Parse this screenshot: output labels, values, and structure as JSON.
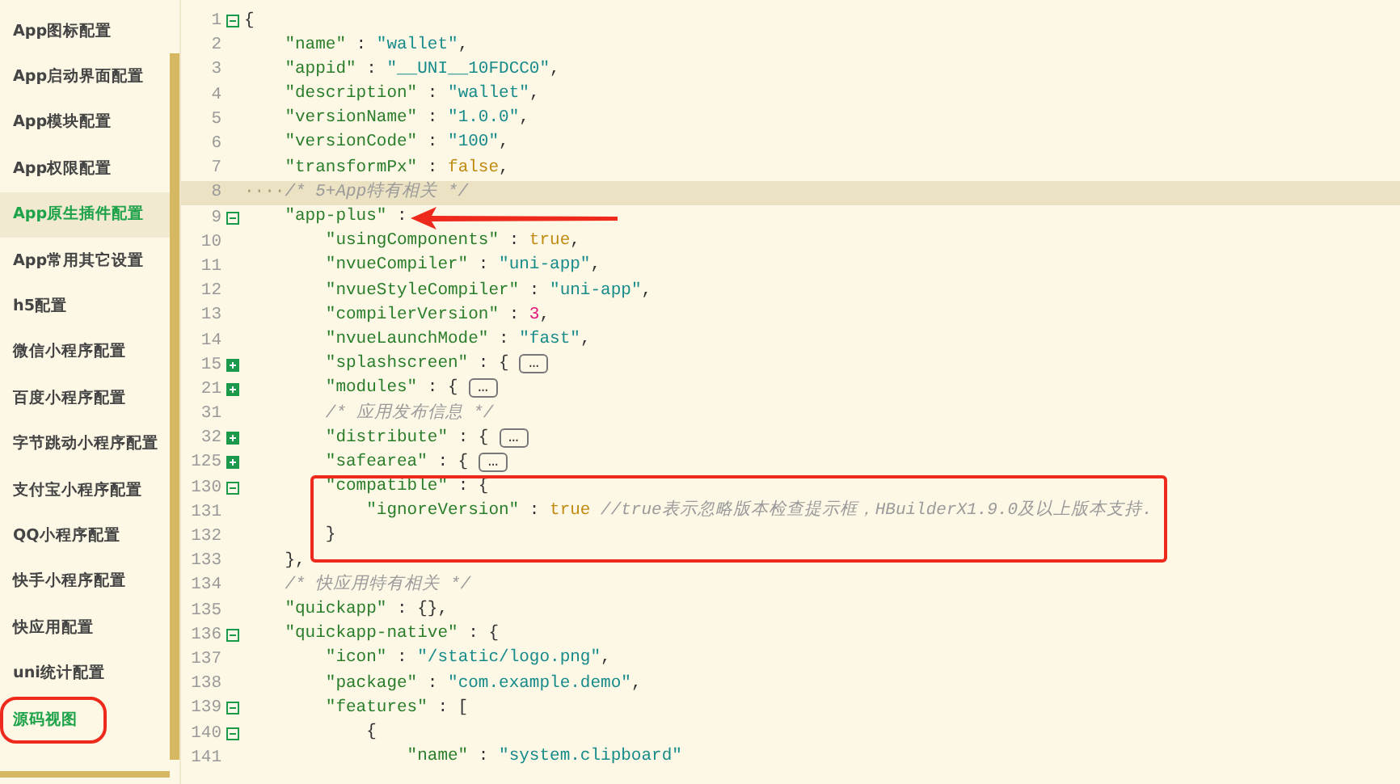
{
  "sidebar": {
    "items": [
      {
        "label": "App图标配置",
        "selected": false,
        "active": false,
        "circled": false
      },
      {
        "label": "App启动界面配置",
        "selected": false,
        "active": false,
        "circled": false
      },
      {
        "label": "App模块配置",
        "selected": false,
        "active": false,
        "circled": false
      },
      {
        "label": "App权限配置",
        "selected": false,
        "active": false,
        "circled": false
      },
      {
        "label": "App原生插件配置",
        "selected": true,
        "active": true,
        "circled": false
      },
      {
        "label": "App常用其它设置",
        "selected": false,
        "active": false,
        "circled": false
      },
      {
        "label": "h5配置",
        "selected": false,
        "active": false,
        "circled": false
      },
      {
        "label": "微信小程序配置",
        "selected": false,
        "active": false,
        "circled": false
      },
      {
        "label": "百度小程序配置",
        "selected": false,
        "active": false,
        "circled": false
      },
      {
        "label": "字节跳动小程序配置",
        "selected": false,
        "active": false,
        "circled": false
      },
      {
        "label": "支付宝小程序配置",
        "selected": false,
        "active": false,
        "circled": false
      },
      {
        "label": "QQ小程序配置",
        "selected": false,
        "active": false,
        "circled": false
      },
      {
        "label": "快手小程序配置",
        "selected": false,
        "active": false,
        "circled": false
      },
      {
        "label": "快应用配置",
        "selected": false,
        "active": false,
        "circled": false
      },
      {
        "label": "uni统计配置",
        "selected": false,
        "active": false,
        "circled": false
      },
      {
        "label": "源码视图",
        "selected": false,
        "active": true,
        "circled": true
      }
    ]
  },
  "editor": {
    "lines": [
      {
        "num": "1",
        "collapsed": false,
        "tokens": [
          {
            "kind": "punct",
            "text": "{"
          }
        ],
        "children": [
          {
            "num": "2",
            "tokens": [
              {
                "kind": "key",
                "text": "\"name\""
              },
              {
                "kind": "punct",
                "text": " : "
              },
              {
                "kind": "string",
                "text": "\"wallet\""
              },
              {
                "kind": "punct",
                "text": ","
              }
            ]
          },
          {
            "num": "3",
            "tokens": [
              {
                "kind": "key",
                "text": "\"appid\""
              },
              {
                "kind": "punct",
                "text": " : "
              },
              {
                "kind": "string",
                "text": "\"__UNI__10FDCC0\""
              },
              {
                "kind": "punct",
                "text": ","
              }
            ]
          },
          {
            "num": "4",
            "tokens": [
              {
                "kind": "key",
                "text": "\"description\""
              },
              {
                "kind": "punct",
                "text": " : "
              },
              {
                "kind": "string",
                "text": "\"wallet\""
              },
              {
                "kind": "punct",
                "text": ","
              }
            ]
          },
          {
            "num": "5",
            "tokens": [
              {
                "kind": "key",
                "text": "\"versionName\""
              },
              {
                "kind": "punct",
                "text": " : "
              },
              {
                "kind": "string",
                "text": "\"1.0.0\""
              },
              {
                "kind": "punct",
                "text": ","
              }
            ]
          },
          {
            "num": "6",
            "tokens": [
              {
                "kind": "key",
                "text": "\"versionCode\""
              },
              {
                "kind": "punct",
                "text": " : "
              },
              {
                "kind": "string",
                "text": "\"100\""
              },
              {
                "kind": "punct",
                "text": ","
              }
            ]
          },
          {
            "num": "7",
            "tokens": [
              {
                "kind": "key",
                "text": "\"transformPx\""
              },
              {
                "kind": "punct",
                "text": " : "
              },
              {
                "kind": "literal",
                "text": "false"
              },
              {
                "kind": "punct",
                "text": ","
              }
            ]
          },
          {
            "num": "8",
            "highlighted": true,
            "tokens": [
              {
                "kind": "whitespace",
                "text": "····"
              },
              {
                "kind": "comment",
                "text": "/* 5+App特有相关 */"
              }
            ]
          },
          {
            "num": "9",
            "collapsed": false,
            "tokens": [
              {
                "kind": "key",
                "text": "\"app-plus\""
              },
              {
                "kind": "punct",
                "text": " :"
              }
            ],
            "children": [
              {
                "num": "10",
                "tokens": [
                  {
                    "kind": "key",
                    "text": "\"usingComponents\""
                  },
                  {
                    "kind": "punct",
                    "text": " : "
                  },
                  {
                    "kind": "literal",
                    "text": "true"
                  },
                  {
                    "kind": "punct",
                    "text": ","
                  }
                ]
              },
              {
                "num": "11",
                "tokens": [
                  {
                    "kind": "key",
                    "text": "\"nvueCompiler\""
                  },
                  {
                    "kind": "punct",
                    "text": " : "
                  },
                  {
                    "kind": "string",
                    "text": "\"uni-app\""
                  },
                  {
                    "kind": "punct",
                    "text": ","
                  }
                ]
              },
              {
                "num": "12",
                "tokens": [
                  {
                    "kind": "key",
                    "text": "\"nvueStyleCompiler\""
                  },
                  {
                    "kind": "punct",
                    "text": " : "
                  },
                  {
                    "kind": "string",
                    "text": "\"uni-app\""
                  },
                  {
                    "kind": "punct",
                    "text": ","
                  }
                ]
              },
              {
                "num": "13",
                "tokens": [
                  {
                    "kind": "key",
                    "text": "\"compilerVersion\""
                  },
                  {
                    "kind": "punct",
                    "text": " : "
                  },
                  {
                    "kind": "number",
                    "text": "3"
                  },
                  {
                    "kind": "punct",
                    "text": ","
                  }
                ]
              },
              {
                "num": "14",
                "tokens": [
                  {
                    "kind": "key",
                    "text": "\"nvueLaunchMode\""
                  },
                  {
                    "kind": "punct",
                    "text": " : "
                  },
                  {
                    "kind": "string",
                    "text": "\"fast\""
                  },
                  {
                    "kind": "punct",
                    "text": ","
                  }
                ]
              },
              {
                "num": "15",
                "collapsed": true,
                "tokens": [
                  {
                    "kind": "key",
                    "text": "\"splashscreen\""
                  },
                  {
                    "kind": "punct",
                    "text": " : { "
                  },
                  {
                    "kind": "ellipsis",
                    "text": "…"
                  }
                ]
              },
              {
                "num": "21",
                "collapsed": true,
                "tokens": [
                  {
                    "kind": "key",
                    "text": "\"modules\""
                  },
                  {
                    "kind": "punct",
                    "text": " : { "
                  },
                  {
                    "kind": "ellipsis",
                    "text": "…"
                  }
                ]
              },
              {
                "num": "31",
                "tokens": [
                  {
                    "kind": "comment",
                    "text": "/* 应用发布信息 */"
                  }
                ]
              },
              {
                "num": "32",
                "collapsed": true,
                "tokens": [
                  {
                    "kind": "key",
                    "text": "\"distribute\""
                  },
                  {
                    "kind": "punct",
                    "text": " : { "
                  },
                  {
                    "kind": "ellipsis",
                    "text": "…"
                  }
                ]
              },
              {
                "num": "125",
                "collapsed": true,
                "tokens": [
                  {
                    "kind": "key",
                    "text": "\"safearea\""
                  },
                  {
                    "kind": "punct",
                    "text": " : { "
                  },
                  {
                    "kind": "ellipsis",
                    "text": "…"
                  }
                ]
              },
              {
                "num": "130",
                "collapsed": false,
                "tokens": [
                  {
                    "kind": "key",
                    "text": "\"compatible\""
                  },
                  {
                    "kind": "punct",
                    "text": " : {"
                  }
                ],
                "children": [
                  {
                    "num": "131",
                    "tokens": [
                      {
                        "kind": "key",
                        "text": "\"ignoreVersion\""
                      },
                      {
                        "kind": "punct",
                        "text": " : "
                      },
                      {
                        "kind": "literal",
                        "text": "true"
                      },
                      {
                        "kind": "comment",
                        "text": "//true表示忽略版本检查提示框，HBuilderX1.9.0及以上版本支持."
                      }
                    ]
                  }
                ]
              },
              {
                "num": "132",
                "tokens": [
                  {
                    "kind": "punct",
                    "text": "}"
                  }
                ]
              }
            ]
          },
          {
            "num": "133",
            "tokens": [
              {
                "kind": "punct",
                "text": "},"
              }
            ]
          },
          {
            "num": "134",
            "tokens": [
              {
                "kind": "comment",
                "text": "/* 快应用特有相关 */"
              }
            ]
          },
          {
            "num": "135",
            "tokens": [
              {
                "kind": "key",
                "text": "\"quickapp\""
              },
              {
                "kind": "punct",
                "text": " : {},"
              }
            ]
          },
          {
            "num": "136",
            "collapsed": false,
            "tokens": [
              {
                "kind": "key",
                "text": "\"quickapp-native\""
              },
              {
                "kind": "punct",
                "text": " : {"
              }
            ],
            "children": [
              {
                "num": "137",
                "tokens": [
                  {
                    "kind": "key",
                    "text": "\"icon\""
                  },
                  {
                    "kind": "punct",
                    "text": " : "
                  },
                  {
                    "kind": "string",
                    "text": "\"/static/logo.png\""
                  },
                  {
                    "kind": "punct",
                    "text": ","
                  }
                ]
              },
              {
                "num": "138",
                "tokens": [
                  {
                    "kind": "key",
                    "text": "\"package\""
                  },
                  {
                    "kind": "punct",
                    "text": " : "
                  },
                  {
                    "kind": "string",
                    "text": "\"com.example.demo\""
                  },
                  {
                    "kind": "punct",
                    "text": ","
                  }
                ]
              },
              {
                "num": "139",
                "collapsed": false,
                "tokens": [
                  {
                    "kind": "key",
                    "text": "\"features\""
                  },
                  {
                    "kind": "punct",
                    "text": " : ["
                  }
                ],
                "children": [
                  {
                    "num": "140",
                    "collapsed": false,
                    "tokens": [
                      {
                        "kind": "punct",
                        "text": "{"
                      }
                    ],
                    "children": [
                      {
                        "num": "141",
                        "tokens": [
                          {
                            "kind": "key",
                            "text": "\"name\""
                          },
                          {
                            "kind": "punct",
                            "text": " : "
                          },
                          {
                            "kind": "string",
                            "text": "\"system.clipboard\""
                          }
                        ]
                      }
                    ]
                  }
                ]
              }
            ]
          }
        ]
      }
    ]
  }
}
